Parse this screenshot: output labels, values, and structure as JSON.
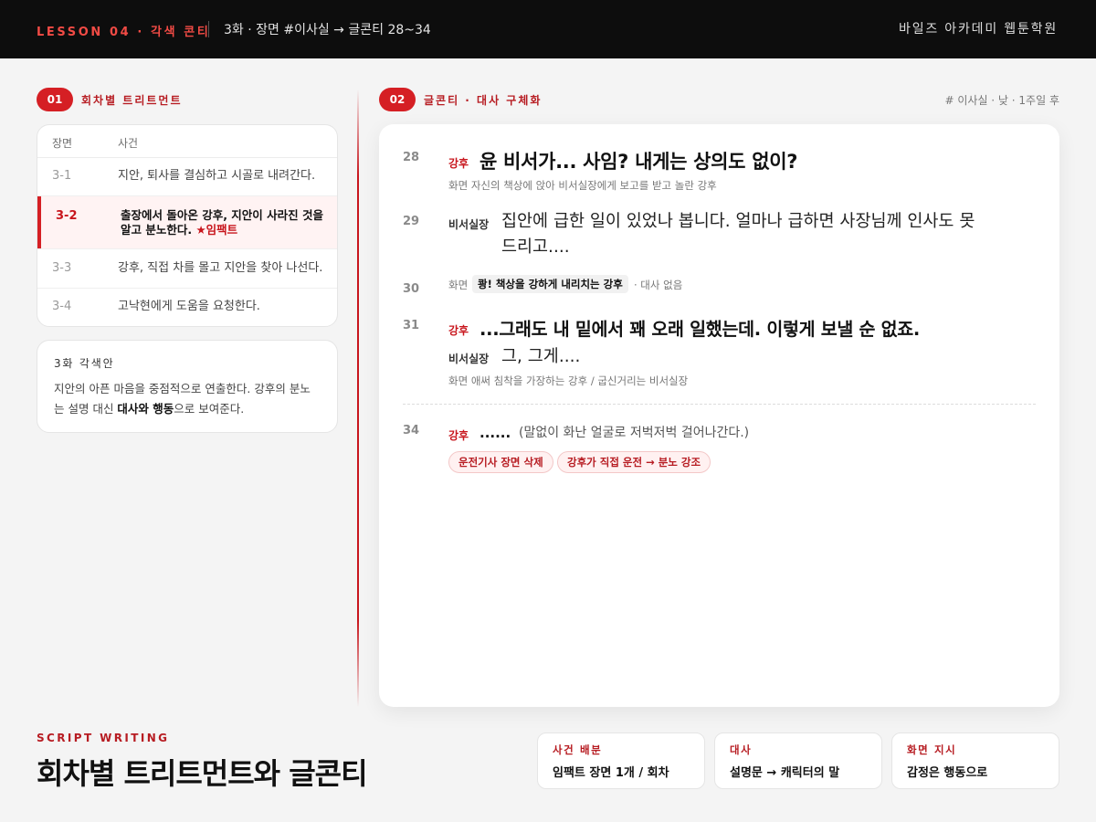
{
  "header": {
    "lesson": "LESSON 04 · 각색 콘티",
    "crumb": "3화 · 장면 #이사실 → 글콘티 28~34",
    "academy": "바일즈 아카데미 웹툰학원"
  },
  "treatment": {
    "number": "01",
    "title": "회차별 트리트먼트",
    "columns": [
      "장면",
      "사건"
    ],
    "rows": [
      {
        "no": "3-1",
        "desc": "지안, 퇴사를 결심하고 시골로 내려간다."
      },
      {
        "no": "3-2",
        "desc": "출장에서 돌아온 강후, 지안이 사라진 것을 알고 분노한다.",
        "star": "★임팩트"
      },
      {
        "no": "3-3",
        "desc": "강후, 직접 차를 몰고 지안을 찾아 나선다."
      },
      {
        "no": "3-4",
        "desc": "고낙현에게 도움을 요청한다."
      }
    ]
  },
  "note": {
    "title": "3화 각색안",
    "pre": "지안의 아픈 마음을 중점적으로 연출한다. 강후의 분노는 설명 대신 ",
    "bold": "대사와 행동",
    "post": "으로 보여준다."
  },
  "conti": {
    "number": "02",
    "title": "글콘티 · 대사 구체화",
    "meta": "# 이사실 · 낮 · 1주일 후",
    "l28": {
      "no": "28",
      "speaker": "강후",
      "line": "윤 비서가... 사임? 내게는 상의도 없이?",
      "caption": "화면 자신의 책상에 앉아 비서실장에게 보고를 받고 놀란 강후"
    },
    "l29": {
      "no": "29",
      "speaker": "비서실장",
      "line": "집안에 급한 일이 있었나 봅니다. 얼마나 급하면 사장님께 인사도 못 드리고...."
    },
    "l30": {
      "no": "30",
      "label": "화면",
      "chip": "쾅! 책상을 강하게 내리치는 강후",
      "suffix": "· 대사 없음"
    },
    "l31": {
      "no": "31",
      "speaker": "강후",
      "line": "...그래도 내 밑에서 꽤 오래 일했는데. 이렇게 보낼 순 없죠.",
      "speaker2": "비서실장",
      "line2": "그, 그게....",
      "caption": "화면 애써 침착을 가장하는 강후 / 굽신거리는 비서실장"
    },
    "l34": {
      "no": "34",
      "speaker": "강후",
      "dots": "......",
      "line": "(말없이 화난 얼굴로 저벅저벅 걸어나간다.)"
    },
    "tags": [
      "운전기사 장면 삭제",
      "강후가 직접 운전 → 분노 강조"
    ]
  },
  "footer": {
    "eyebrow": "SCRIPT WRITING",
    "title": "회차별 트리트먼트와 글콘티",
    "cards": [
      {
        "label": "사건 배분",
        "value": "임팩트 장면 1개 / 회차"
      },
      {
        "label": "대사",
        "value": "설명문 → 캐릭터의 말"
      },
      {
        "label": "화면 지시",
        "value": "감정은 행동으로"
      }
    ]
  },
  "colors": {
    "accent": "#d51f24",
    "topbar": "#0d0d0d",
    "background": "#f4f4f4"
  }
}
